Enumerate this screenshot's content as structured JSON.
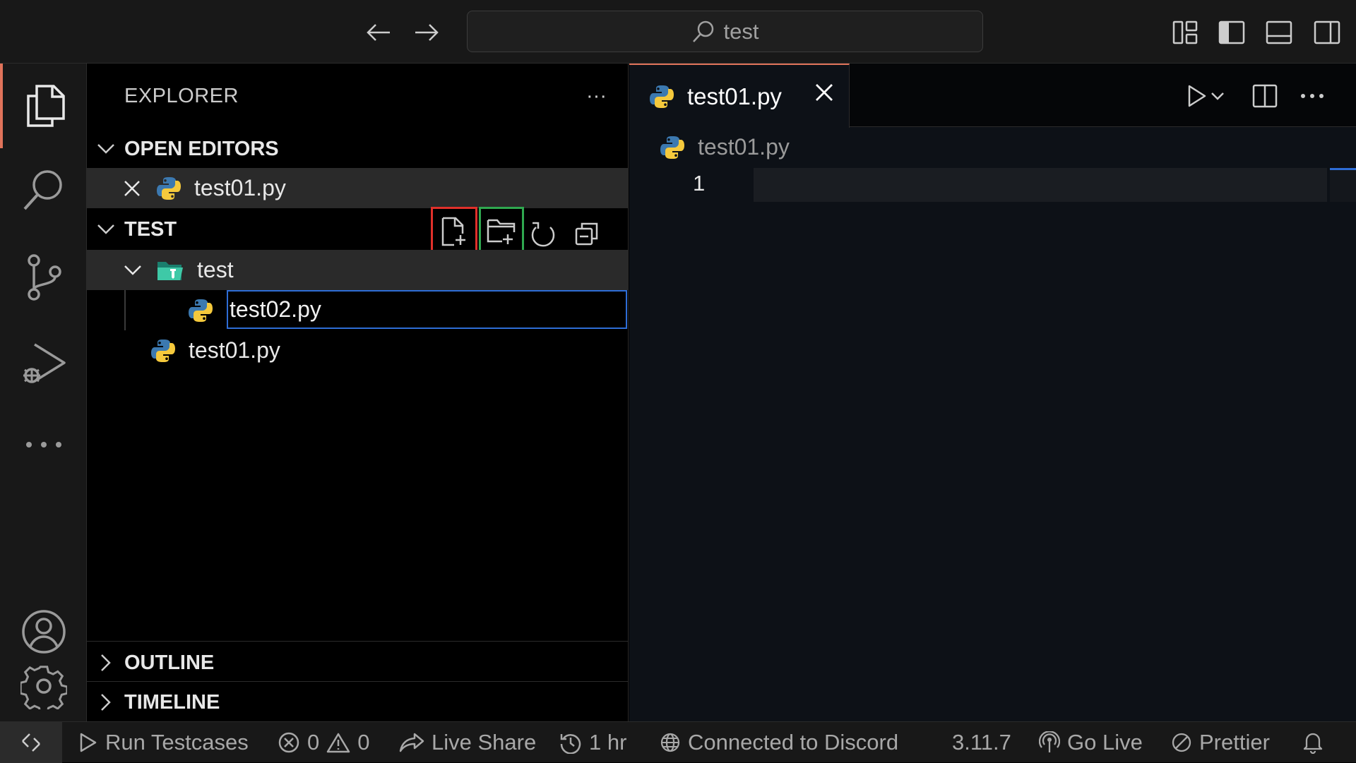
{
  "titlebar": {
    "search_text": "test",
    "icons": [
      "arrow-left-icon",
      "arrow-right-icon",
      "search-icon",
      "customize-layout-icon",
      "toggle-primary-sidebar-icon",
      "toggle-panel-icon",
      "toggle-secondary-sidebar-icon"
    ]
  },
  "activity_bar": {
    "items": [
      "files-icon",
      "search-icon",
      "source-control-icon",
      "run-debug-icon",
      "more-icon",
      "accounts-icon",
      "settings-gear-icon"
    ],
    "active": "files-icon"
  },
  "sidebar": {
    "title": "EXPLORER",
    "more": "···",
    "open_editors": {
      "header": "OPEN EDITORS",
      "files": [
        {
          "name": "test01.py"
        }
      ]
    },
    "workspace": {
      "header": "TEST",
      "folder": "test",
      "rename_value": "test02.py",
      "root_file": "test01.py",
      "toolbar": [
        "new-file-icon",
        "new-folder-icon",
        "refresh-icon",
        "collapse-all-icon"
      ],
      "highlight_colors": {
        "new_file": "#e0302a",
        "new_folder": "#2fa84f"
      }
    },
    "outline": "OUTLINE",
    "timeline": "TIMELINE"
  },
  "editor": {
    "tab_label": "test01.py",
    "breadcrumb": "test01.py",
    "line_numbers": [
      "1"
    ],
    "accent": "#e0735a"
  },
  "statusbar": {
    "run_testcases": "Run Testcases",
    "errors": "0",
    "warnings": "0",
    "live_share": "Live Share",
    "time": "1 hr",
    "discord": "Connected to Discord",
    "python_version": "3.11.7",
    "go_live": "Go Live",
    "prettier": "Prettier"
  }
}
